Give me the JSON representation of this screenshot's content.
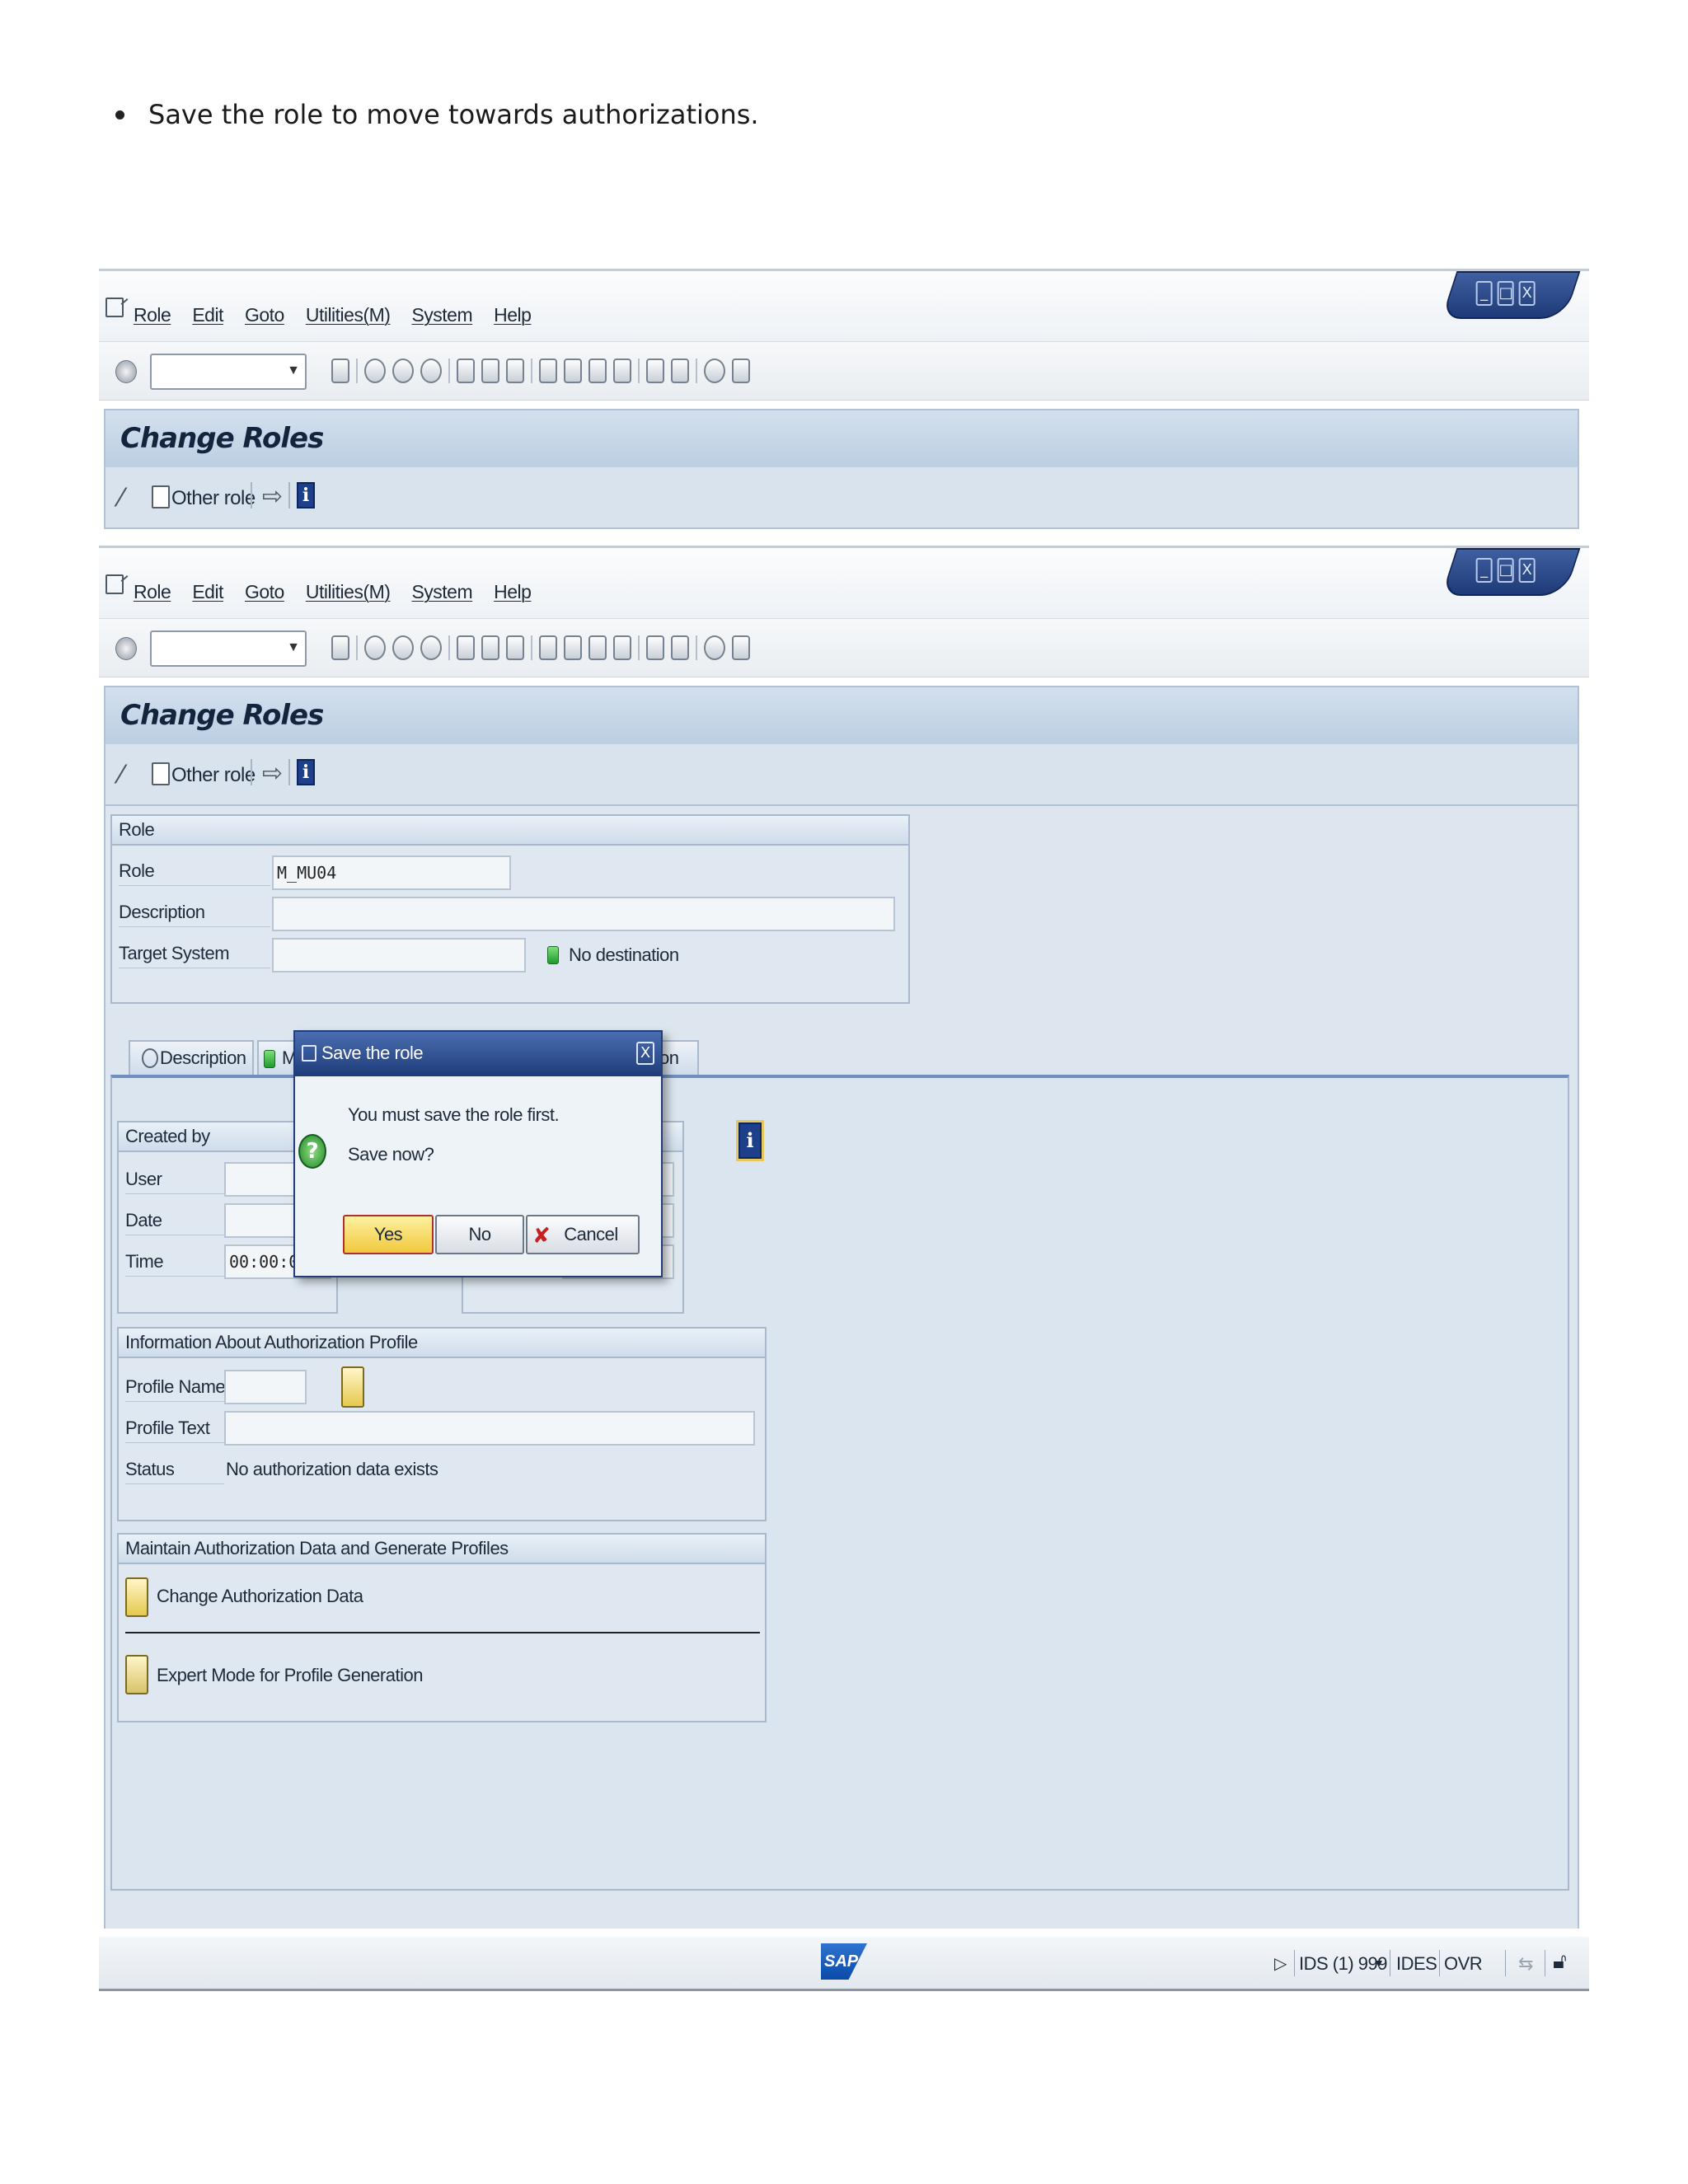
{
  "instruction": "Save the role to move towards authorizations.",
  "menu": {
    "items": [
      "Role",
      "Edit",
      "Goto",
      "Utilities(M)",
      "System",
      "Help"
    ]
  },
  "window_controls": [
    "_",
    "□",
    "X"
  ],
  "screen": {
    "title": "Change Roles",
    "other_role_label": "Other role"
  },
  "role_group": {
    "header": "Role",
    "role_label": "Role",
    "role_value": "M_MU04",
    "description_label": "Description",
    "description_value": "",
    "target_label": "Target System",
    "target_value": "",
    "destination_status": "No destination"
  },
  "tabs": {
    "description": "Description",
    "partial_left": "M",
    "partial_right": "tion"
  },
  "created_by": {
    "header": "Created by",
    "user_label": "User",
    "date_label": "Date",
    "time_label": "Time",
    "time_value": "00:00:00"
  },
  "profile_info": {
    "header": "Information About Authorization Profile",
    "name_label": "Profile Name",
    "text_label": "Profile Text",
    "status_label": "Status",
    "status_value": "No authorization data exists"
  },
  "maintain": {
    "header": "Maintain Authorization Data and Generate Profiles",
    "change_label": "Change Authorization Data",
    "expert_label": "Expert Mode for Profile Generation"
  },
  "dialog": {
    "title": "Save the role",
    "close": "X",
    "line1": "You must save the role first.",
    "line2": "Save now?",
    "yes": "Yes",
    "no": "No",
    "cancel": "Cancel"
  },
  "status_bar": {
    "logo": "SAP",
    "system": "IDS (1) 999",
    "client": "IDES",
    "mode": "OVR"
  },
  "colors": {
    "title_bar": "#bccfe3",
    "dialog_title": "#1e3c7a",
    "primary_button": "#f0c83c",
    "status_led": "#1f9a2c"
  }
}
